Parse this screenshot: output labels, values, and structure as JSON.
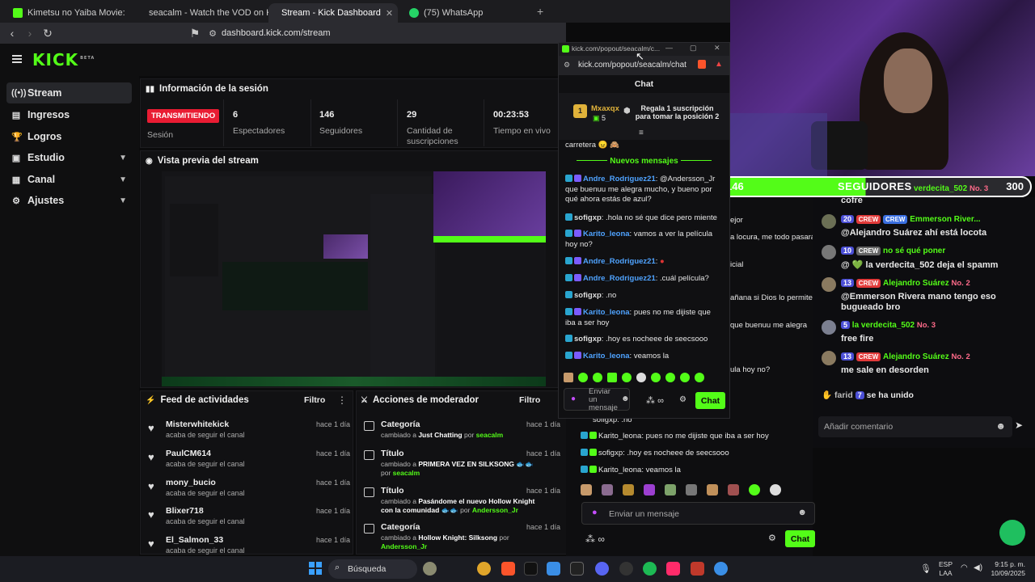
{
  "browser": {
    "tabs": [
      {
        "label": "Kimetsu no Yaiba Movie: Mugen Res"
      },
      {
        "label": "seacalm - Watch the VOD on Kick"
      },
      {
        "label": "Stream - Kick Dashboard"
      },
      {
        "label": "(75) WhatsApp"
      }
    ],
    "url": "dashboard.kick.com/stream"
  },
  "kick": {
    "logo": "KICK",
    "logo_sup": "BETA"
  },
  "sidebar": {
    "items": [
      {
        "label": "Stream",
        "icon": "stream-icon"
      },
      {
        "label": "Ingresos",
        "icon": "income-icon"
      },
      {
        "label": "Logros",
        "icon": "trophy-icon"
      },
      {
        "label": "Estudio",
        "icon": "studio-icon"
      },
      {
        "label": "Canal",
        "icon": "channel-icon"
      },
      {
        "label": "Ajustes",
        "icon": "gear-icon"
      }
    ]
  },
  "session": {
    "title": "Información de la sesión",
    "live_badge": "TRANSMITIENDO",
    "session_label": "Sesión",
    "stats": [
      {
        "value": "6",
        "label": "Espectadores"
      },
      {
        "value": "146",
        "label": "Seguidores"
      },
      {
        "value": "29",
        "label": "Cantidad de suscripciones"
      },
      {
        "value": "00:23:53",
        "label": "Tiempo en vivo"
      }
    ]
  },
  "preview": {
    "title": "Vista previa del stream"
  },
  "feed": {
    "title": "Feed de actividades",
    "filter": "Filtro",
    "items": [
      {
        "name": "Misterwhitekick",
        "sub": "acaba de seguir el canal",
        "time": "hace 1 día"
      },
      {
        "name": "PaulCM614",
        "sub": "acaba de seguir el canal",
        "time": "hace 1 día"
      },
      {
        "name": "mony_bucio",
        "sub": "acaba de seguir el canal",
        "time": "hace 1 día"
      },
      {
        "name": "Blixer718",
        "sub": "acaba de seguir el canal",
        "time": "hace 1 día"
      },
      {
        "name": "El_Salmon_33",
        "sub": "acaba de seguir el canal",
        "time": "hace 1 día"
      }
    ]
  },
  "moderator": {
    "title": "Acciones de moderador",
    "filter": "Filtro",
    "items": [
      {
        "name": "Categoría",
        "pre": "cambiado a ",
        "bold": "Just Chatting",
        "mid": " por ",
        "user": "seacalm",
        "time": "hace 1 día"
      },
      {
        "name": "Título",
        "pre": "cambiado a ",
        "bold": "PRIMERA VEZ EN SILKSONG",
        "mid": " por ",
        "user": "seacalm",
        "time": "hace 1 día"
      },
      {
        "name": "Título",
        "pre": "cambiado a ",
        "bold": "Pasándome el nuevo Hollow Knight con la comunidad",
        "mid": " por ",
        "user": "Andersson_Jr",
        "time": "hace 1 día"
      },
      {
        "name": "Categoría",
        "pre": "cambiado a ",
        "bold": "Hollow Knight: Silksong",
        "mid": " por ",
        "user": "Andersson_Jr",
        "time": "hace 1 día"
      }
    ]
  },
  "popout": {
    "window_title": "kick.com/popout/seacalm/c...",
    "url": "kick.com/popout/seacalm/chat",
    "chat_title": "Chat",
    "pinned_user": "Mxaxqx",
    "pinned_count": "5",
    "pinned_rank": "1",
    "gift_text_1": "Regala 1 suscripción",
    "gift_text_2": "para tomar la posición 2",
    "prev_msg": "carretera 😠 🙈",
    "new_messages": "Nuevos mensajes",
    "messages": [
      {
        "user": "Andre_Rodriguez21",
        "text": ": @Andersson_Jr que buenuu me alegra mucho, y bueno por qué ahora estás de azul?"
      },
      {
        "user": "sofigxp",
        "text": ": .hola no sé que dice pero miente"
      },
      {
        "user": "Karito_leona",
        "text": ": vamos a ver la película hoy no?"
      },
      {
        "user": "Andre_Rodriguez21",
        "text": ":"
      },
      {
        "user": "Andre_Rodriguez21",
        "text": ": .cuál película?"
      },
      {
        "user": "sofigxp",
        "text": ": .no"
      },
      {
        "user": "Karito_leona",
        "text": ": pues no me dijiste que iba a ser hoy"
      },
      {
        "user": "sofigxp",
        "text": ": .hoy es nocheee de seecsooo"
      },
      {
        "user": "Karito_leona",
        "text": ": veamos la"
      }
    ],
    "input_placeholder": "Enviar un mensaje",
    "infinity": "∞",
    "send": "Chat"
  },
  "overlay": {
    "followers_current": "146",
    "followers_label": "SEGUIDORES",
    "followers_goal": "300"
  },
  "bg_chat_left": {
    "lines": [
      {
        "text": "ejor"
      },
      {
        "text": "a locura, me todo pasará"
      },
      {
        "text": "icial"
      },
      {
        "text": "añana si Dios lo permite"
      },
      {
        "text": "que buenuu me alegra"
      },
      {
        "text": "ula hoy no?"
      },
      {
        "text": "sofigxp: .no"
      },
      {
        "text": "Karito_leona: pues no me dijiste que iba a ser hoy"
      },
      {
        "text": "sofigxp: .hoy es nocheee de seecsooo"
      },
      {
        "text": "Karito_leona: veamos la"
      }
    ],
    "input_placeholder": "Enviar un mensaje",
    "infinity": "∞",
    "send": "Chat"
  },
  "bg_chat_right": {
    "top_partial": "cofre",
    "top_partial_name": "verdecita_502",
    "top_partial_no": "No. 3",
    "messages": [
      {
        "lvl": "20",
        "crew": "CREW",
        "crew2": "CREW",
        "user": "Emmerson River...",
        "text": "@Alejandro Suárez ahí está locota"
      },
      {
        "lvl": "10",
        "crew": "CREW",
        "user": "no sé qué poner",
        "text": "@ 💚 la verdecita_502 deja el spamm"
      },
      {
        "lvl": "13",
        "crew": "CREW",
        "user": "Alejandro Suárez",
        "no": "No. 2",
        "text": "@Emmerson Rivera mano tengo eso bugueado bro"
      },
      {
        "lvl": "5",
        "user": "la verdecita_502",
        "no": "No. 3",
        "text": "free fire"
      },
      {
        "lvl": "13",
        "crew": "CREW",
        "user": "Alejandro Suárez",
        "no": "No. 2",
        "text": "me sale en desorden"
      }
    ],
    "join_user": "farid",
    "join_lvl": "7",
    "join_text": "se ha unido",
    "comment_placeholder": "Añadir comentario"
  },
  "taskbar": {
    "search": "Búsqueda",
    "lang1": "ESP",
    "lang2": "LAA",
    "time": "9:15 p. m.",
    "date": "10/09/2025"
  }
}
